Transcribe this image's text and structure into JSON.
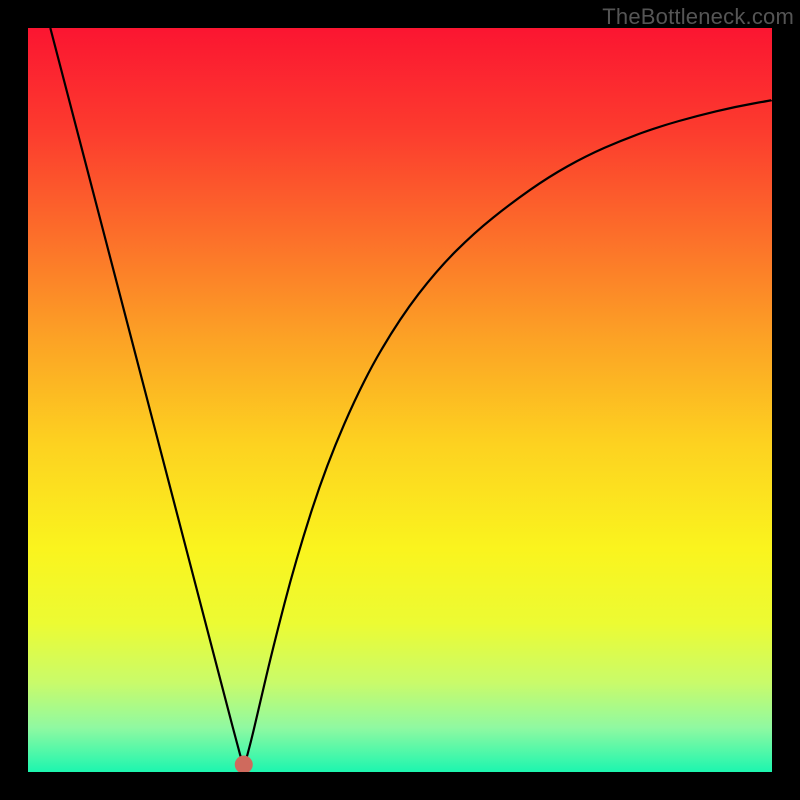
{
  "watermark": "TheBottleneck.com",
  "chart_data": {
    "type": "line",
    "title": "",
    "xlabel": "",
    "ylabel": "",
    "xlim": [
      0,
      1
    ],
    "ylim": [
      0,
      1
    ],
    "background_gradient": {
      "stops": [
        {
          "offset": 0.0,
          "color": "#fb1531"
        },
        {
          "offset": 0.14,
          "color": "#fc3c2e"
        },
        {
          "offset": 0.28,
          "color": "#fc6f2a"
        },
        {
          "offset": 0.42,
          "color": "#fca325"
        },
        {
          "offset": 0.56,
          "color": "#fdd220"
        },
        {
          "offset": 0.7,
          "color": "#faf41e"
        },
        {
          "offset": 0.8,
          "color": "#ecfb33"
        },
        {
          "offset": 0.88,
          "color": "#c9fb6a"
        },
        {
          "offset": 0.94,
          "color": "#90f9a1"
        },
        {
          "offset": 1.0,
          "color": "#1cf6af"
        }
      ]
    },
    "marker": {
      "x": 0.29,
      "y": 0.01,
      "color": "#cf6a5d",
      "r": 9
    },
    "series": [
      {
        "name": "curve",
        "color": "#000000",
        "width": 2.2,
        "x": [
          0.03,
          0.06,
          0.09,
          0.12,
          0.15,
          0.18,
          0.21,
          0.24,
          0.27,
          0.28,
          0.29,
          0.3,
          0.31,
          0.33,
          0.36,
          0.4,
          0.45,
          0.5,
          0.55,
          0.6,
          0.65,
          0.7,
          0.75,
          0.8,
          0.85,
          0.9,
          0.95,
          1.0
        ],
        "y": [
          1.0,
          0.885,
          0.77,
          0.655,
          0.54,
          0.425,
          0.31,
          0.195,
          0.08,
          0.042,
          0.005,
          0.042,
          0.085,
          0.17,
          0.285,
          0.41,
          0.525,
          0.61,
          0.675,
          0.725,
          0.765,
          0.8,
          0.828,
          0.85,
          0.868,
          0.882,
          0.894,
          0.903
        ]
      }
    ]
  }
}
